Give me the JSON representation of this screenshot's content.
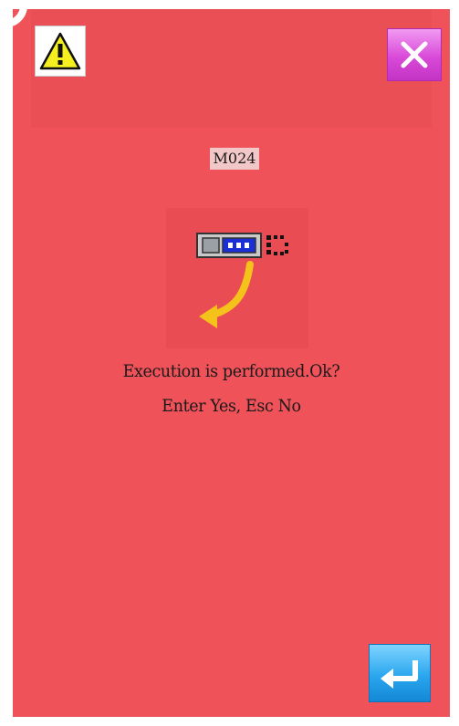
{
  "dialog": {
    "code": "M024",
    "message_line1": "Execution is performed.Ok?",
    "message_line2": "Enter Yes, Esc No"
  },
  "colors": {
    "background": "#ef5259",
    "warning_icon": "#f5ef1f",
    "close_button": "#d94ad9",
    "enter_button": "#2aa6ee",
    "arrow": "#f5c21c"
  },
  "icons": {
    "warning": "warning-triangle-icon",
    "close": "close-x-icon",
    "enter": "enter-return-icon",
    "illustration": "transfer-execute-icon"
  }
}
